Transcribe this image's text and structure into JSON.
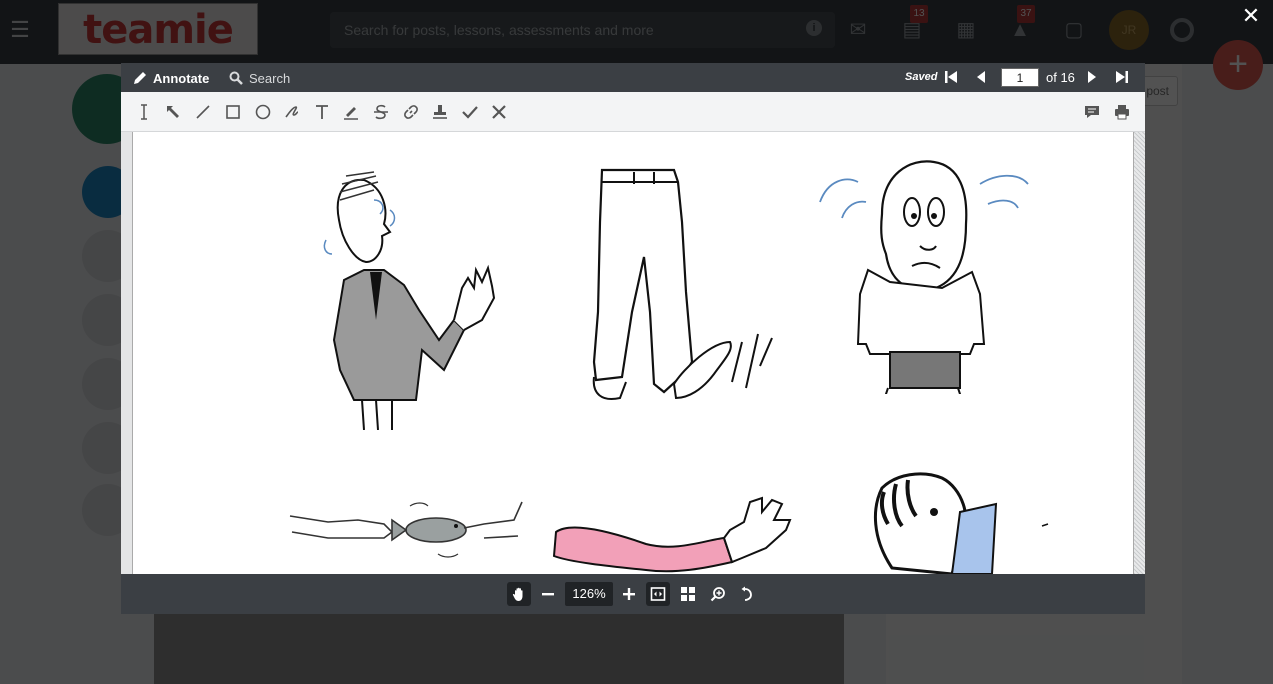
{
  "app": {
    "logo_text": "teamie",
    "search_placeholder": "Search for posts, lessons, assessments and more",
    "badges": {
      "lessons": "13",
      "notifications": "37"
    },
    "avatar_initials": "JR",
    "right_panel_button": "post",
    "colors": {
      "header": "#3a4046",
      "accent": "#e05a52",
      "badge": "#b33a3a"
    }
  },
  "viewer": {
    "annotate_label": "Annotate",
    "search_label": "Search",
    "saved_label": "Saved",
    "page_current": "1",
    "page_total": "of 16",
    "zoom": "126%",
    "tools": [
      "text-select-icon",
      "select-arrow-icon",
      "line-icon",
      "rectangle-icon",
      "ellipse-icon",
      "freehand-icon",
      "text-icon",
      "highlight-icon",
      "strikethrough-icon",
      "link-icon",
      "stamp-icon",
      "checkmark-icon",
      "cross-icon"
    ],
    "right_tools": [
      "comment-icon",
      "print-icon"
    ],
    "bottom_tools": [
      "pan-hand-icon",
      "zoom-out-icon",
      "zoom-in-icon",
      "fit-width-icon",
      "thumbnails-icon",
      "find-zoom-icon",
      "rotate-icon"
    ]
  }
}
